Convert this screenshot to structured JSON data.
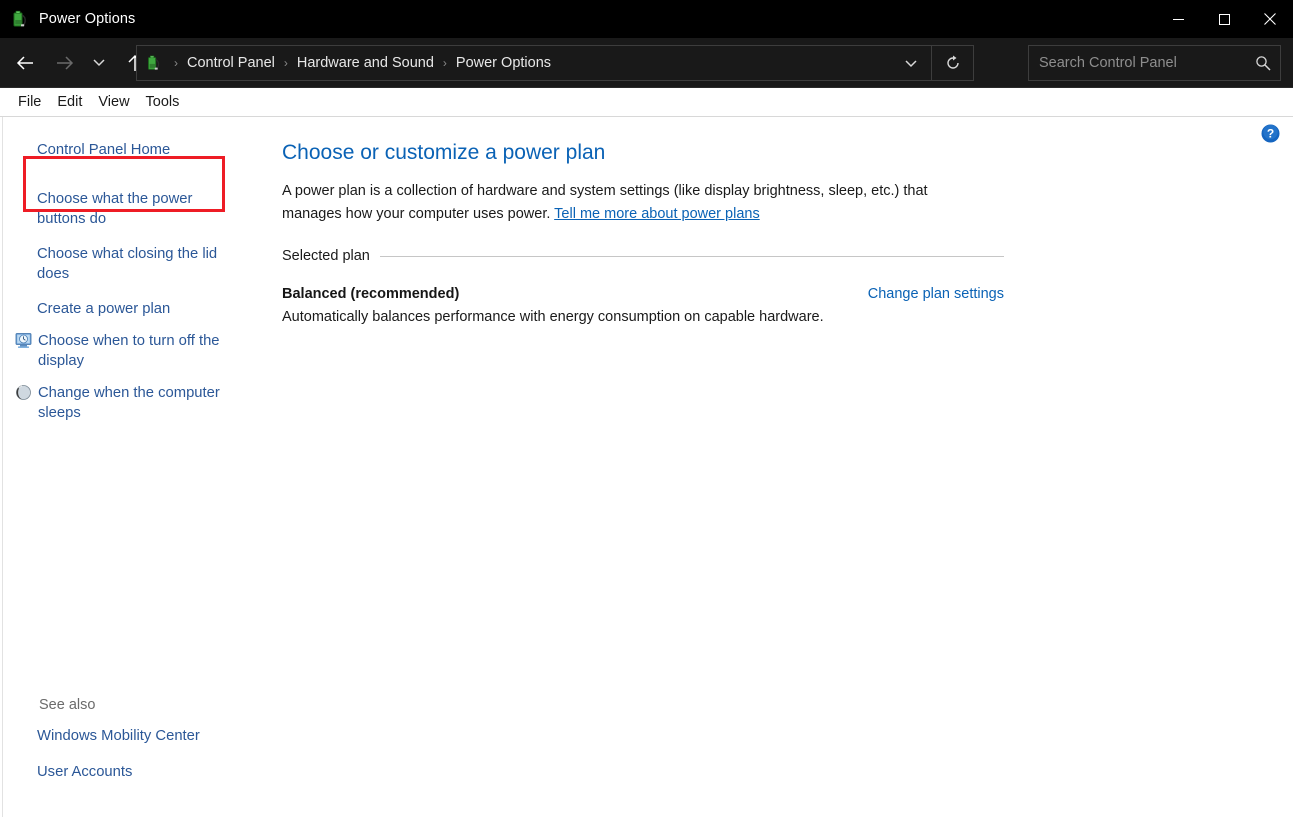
{
  "window": {
    "title": "Power Options",
    "app_icon": "power-plug-battery-icon",
    "controls": {
      "minimize_label": "Minimize",
      "maximize_label": "Maximize",
      "close_label": "Close"
    }
  },
  "navbar": {
    "back_label": "Back",
    "forward_label": "Forward",
    "recent_label": "Recent locations",
    "up_label": "Up one level",
    "address_icon": "power-plug-battery-icon",
    "breadcrumbs": [
      "Control Panel",
      "Hardware and Sound",
      "Power Options"
    ],
    "separator": "›",
    "dropdown_label": "Previous locations",
    "refresh_label": "Refresh",
    "search": {
      "placeholder": "Search Control Panel",
      "value": "",
      "icon": "search-icon"
    }
  },
  "menubar": {
    "items": [
      "File",
      "Edit",
      "View",
      "Tools"
    ]
  },
  "sidebar": {
    "home_link": "Control Panel Home",
    "links": [
      {
        "label": "Choose what the power buttons do",
        "icon": null,
        "highlighted": true
      },
      {
        "label": "Choose what closing the lid does",
        "icon": null,
        "highlighted": false
      },
      {
        "label": "Create a power plan",
        "icon": null,
        "highlighted": false
      },
      {
        "label": "Choose when to turn off the display",
        "icon": "display-clock-icon",
        "highlighted": false
      },
      {
        "label": "Change when the computer sleeps",
        "icon": "sleep-moon-icon",
        "highlighted": false
      }
    ],
    "see_also": {
      "title": "See also",
      "links": [
        "Windows Mobility Center",
        "User Accounts"
      ]
    }
  },
  "content": {
    "help_icon": "help-question-icon",
    "title": "Choose or customize a power plan",
    "description_part1": "A power plan is a collection of hardware and system settings (like display brightness, sleep, etc.) that manages how your computer uses power. ",
    "description_link": "Tell me more about power plans",
    "group_label": "Selected plan",
    "plan": {
      "name": "Balanced (recommended)",
      "change_settings_link": "Change plan settings",
      "description": "Automatically balances performance with energy consumption on capable hardware."
    }
  },
  "colors": {
    "titlebar_bg": "#000000",
    "navbar_bg": "#191919",
    "content_bg": "#ffffff",
    "link_blue": "#2b5797",
    "heading_blue": "#0a62b5",
    "highlight_red": "#ee1c25"
  }
}
